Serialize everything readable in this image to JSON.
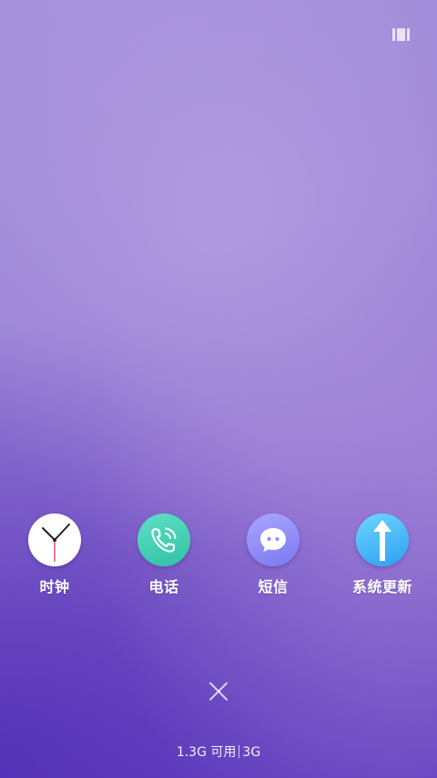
{
  "header": {
    "multiwindow_icon": "multi-window-icon"
  },
  "apps": [
    {
      "label": "时钟",
      "icon": "clock-icon",
      "color": "#ffffff"
    },
    {
      "label": "电话",
      "icon": "phone-icon",
      "color": "#3ccfb0"
    },
    {
      "label": "短信",
      "icon": "message-icon",
      "color": "#8f8cf8"
    },
    {
      "label": "系统更新",
      "icon": "update-arrow-icon",
      "color": "#41b4f5"
    }
  ],
  "close_icon": "close-icon",
  "memory": {
    "available": "1.3G 可用",
    "total": "3G"
  }
}
